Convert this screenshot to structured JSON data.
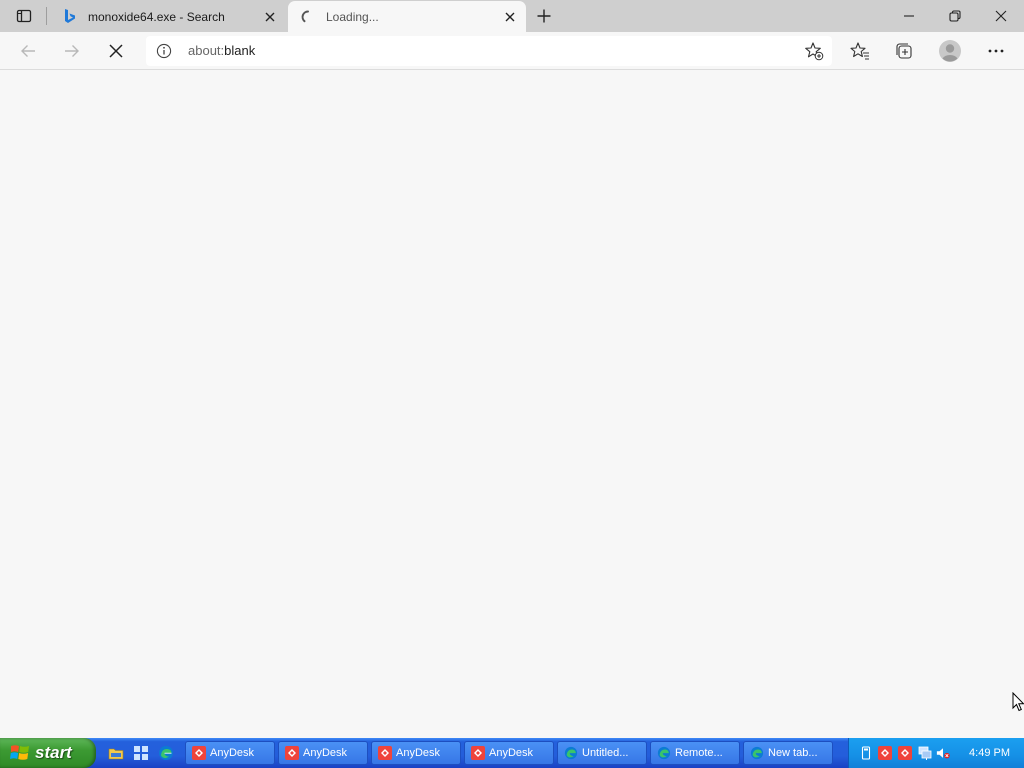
{
  "browser": {
    "tabs": [
      {
        "title": "monoxide64.exe - Search",
        "icon": "bing-icon",
        "active": false
      },
      {
        "title": "Loading...",
        "icon": "loading-spinner-icon",
        "active": true
      }
    ],
    "address_bar": {
      "url_prefix": "about:",
      "url_rest": "blank",
      "info_icon": "info-icon"
    },
    "icons": {
      "tab_actions": "tab-actions-icon",
      "new_tab": "plus-icon",
      "back": "back-arrow-icon",
      "forward": "forward-arrow-icon",
      "stop": "stop-icon",
      "add_favorite": "add-favorite-icon",
      "favorites": "favorites-icon",
      "collections": "collections-icon",
      "profile": "profile-avatar",
      "more": "more-icon",
      "minimize": "minimize-icon",
      "restore": "restore-icon",
      "close": "close-icon"
    }
  },
  "taskbar": {
    "start_label": "start",
    "quick_launch": [
      "explorer-icon",
      "windows-icon",
      "edge-icon"
    ],
    "items": [
      {
        "label": "AnyDesk",
        "icon": "anydesk-icon"
      },
      {
        "label": "AnyDesk",
        "icon": "anydesk-icon"
      },
      {
        "label": "AnyDesk",
        "icon": "anydesk-icon"
      },
      {
        "label": "AnyDesk",
        "icon": "anydesk-icon"
      },
      {
        "label": "Untitled...",
        "icon": "edge-icon"
      },
      {
        "label": "Remote...",
        "icon": "edge-icon"
      },
      {
        "label": "New tab...",
        "icon": "edge-icon"
      }
    ],
    "tray_icons": [
      "usb-device-icon",
      "anydesk-tray-icon",
      "anydesk-tray-icon",
      "network-icon",
      "volume-muted-icon"
    ],
    "clock": "4:49 PM"
  },
  "colors": {
    "taskbar_blue": "#245edb",
    "start_green": "#3c9a33",
    "anydesk_red": "#ef443b",
    "edge_blue": "#0c7bd3",
    "bing_blue": "#1f79d9"
  }
}
